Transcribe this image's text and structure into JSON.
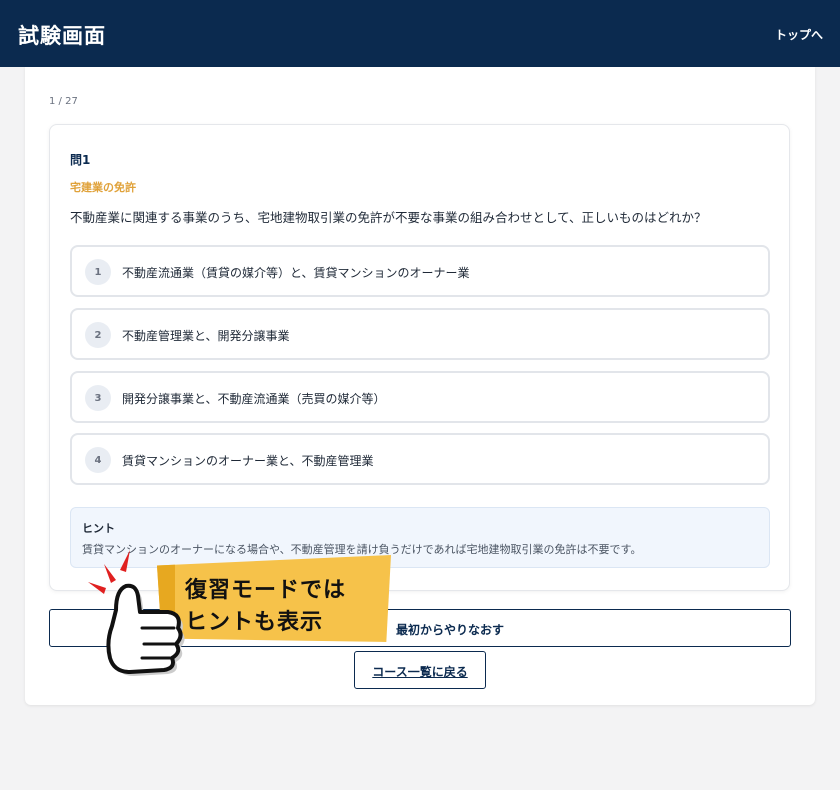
{
  "header": {
    "title": "試験画面",
    "top_link": "トップへ"
  },
  "progress": "1 / 27",
  "question": {
    "number": "問1",
    "category": "宅建業の免許",
    "text": "不動産業に関連する事業のうち、宅地建物取引業の免許が不要な事業の組み合わせとして、正しいものはどれか？",
    "options": [
      {
        "num": "1",
        "label": "不動産流通業（賃貸の媒介等）と、賃貸マンションのオーナー業"
      },
      {
        "num": "2",
        "label": "不動産管理業と、開発分譲事業"
      },
      {
        "num": "3",
        "label": "開発分譲事業と、不動産流通業（売買の媒介等）"
      },
      {
        "num": "4",
        "label": "賃貸マンションのオーナー業と、不動産管理業"
      }
    ]
  },
  "hint": {
    "title": "ヒント",
    "text": "賃貸マンションのオーナーになる場合や、不動産管理を請け負うだけであれば宅地建物取引業の免許は不要です。"
  },
  "buttons": {
    "restart": "最初からやりなおす",
    "back": "コース一覧に戻る"
  },
  "promo": {
    "line1": "復習モードでは",
    "line2": "ヒントも表示"
  },
  "colors": {
    "header_bg": "#0b2a4f",
    "accent": "#e0a23a",
    "promo_bg": "#f6c24a",
    "hint_bg": "#f1f6fd"
  },
  "icons": {
    "promo": "thumbs-up-icon"
  }
}
